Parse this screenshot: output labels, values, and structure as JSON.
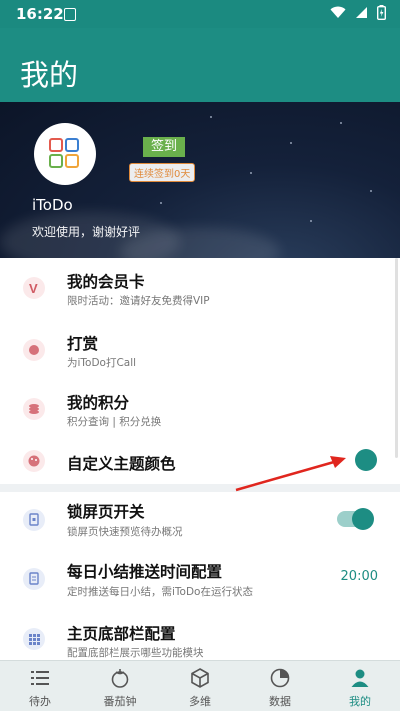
{
  "status": {
    "time": "16:22"
  },
  "appbar": {
    "title": "我的"
  },
  "profile": {
    "app_name": "iToDo",
    "welcome": "欢迎使用，谢谢好评",
    "signin_label": "签到",
    "streak_label": "连续签到0天"
  },
  "menu": [
    {
      "title": "我的会员卡",
      "subtitle": "限时活动：邀请好友免费得VIP",
      "icon": "vip-icon"
    },
    {
      "title": "打赏",
      "subtitle": "为iToDo打Call",
      "icon": "coin-icon"
    },
    {
      "title": "我的积分",
      "subtitle": "积分查询 | 积分兑换",
      "icon": "points-icon"
    },
    {
      "title": "自定义主题颜色",
      "subtitle": "",
      "icon": "palette-icon"
    },
    {
      "title": "锁屏页开关",
      "subtitle": "锁屏页快速预览待办概况",
      "icon": "lockscreen-icon",
      "toggle_on": true
    },
    {
      "title": "每日小结推送时间配置",
      "subtitle": "定时推送每日小结，需iToDo在运行状态",
      "icon": "summary-icon",
      "value": "20:00"
    },
    {
      "title": "主页底部栏配置",
      "subtitle": "配置底部栏展示哪些功能模块",
      "icon": "grid-icon"
    }
  ],
  "theme_color": "#1d8d83",
  "tabs": [
    {
      "label": "待办",
      "icon": "list-icon"
    },
    {
      "label": "番茄钟",
      "icon": "tomato-icon"
    },
    {
      "label": "多维",
      "icon": "cube-icon"
    },
    {
      "label": "数据",
      "icon": "pie-chart-icon"
    },
    {
      "label": "我的",
      "icon": "user-icon",
      "active": true
    }
  ]
}
